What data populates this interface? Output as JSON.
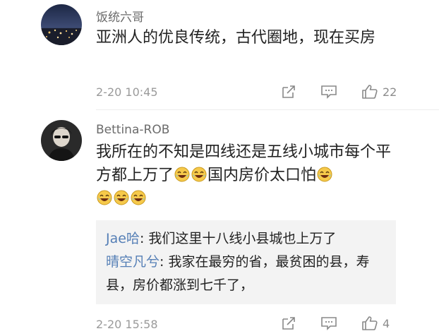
{
  "comments": [
    {
      "username": "饭统六哥",
      "text": "亚洲人的优良传统，古代圈地，现在买房",
      "time": "2-20 10:45",
      "likes": "22",
      "icons": [
        "share-icon",
        "comment-icon",
        "like-icon"
      ]
    },
    {
      "username": "Bettina-ROB",
      "text_a": "我所在的不知是四线还是五线小城市每个平方都上万了",
      "text_b": "国内房价太口怕",
      "emoji": "laugh-cry-emoji",
      "time": "2-20 15:58",
      "likes": "4",
      "icons": [
        "share-icon",
        "comment-icon",
        "like-icon"
      ],
      "replies": [
        {
          "author": "Jae哈",
          "separator": ":",
          "text": "我们这里十八线小县城也上万了"
        },
        {
          "author": "晴空凡兮",
          "separator": ":",
          "text": "我家在最穷的省，最贫困的县，寿县，房价都涨到七千了，"
        }
      ]
    }
  ],
  "colors": {
    "username": "#6b6b6b",
    "reply_author": "#557fb6",
    "meta": "#9a9a9a",
    "reply_bg": "#f3f3f3"
  }
}
